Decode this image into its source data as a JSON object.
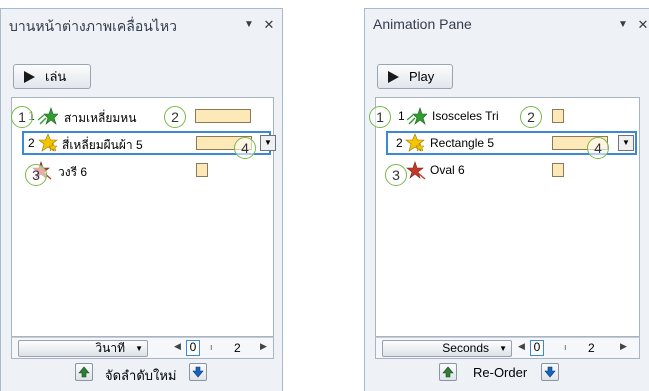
{
  "left_pane": {
    "title": "บานหน้าต่างภาพเคลื่อนไหว",
    "play_label": "เล่น",
    "rows": [
      {
        "num": "1",
        "text": "สามเหลี่ยมหน"
      },
      {
        "num": "2",
        "text": "สี่เหลี่ยมผืนผ้า 5"
      },
      {
        "num": "3",
        "text": "วงรี 6"
      }
    ],
    "seconds_label": "วินาที",
    "timeline_zero": "0",
    "timeline_two": "2",
    "reorder_label": "จัดลำดับใหม่"
  },
  "right_pane": {
    "title": "Animation Pane",
    "play_label": "Play",
    "rows": [
      {
        "num": "1",
        "text": "Isosceles Tri"
      },
      {
        "num": "2",
        "text": "Rectangle 5"
      },
      {
        "num": "3",
        "text": "Oval 6"
      }
    ],
    "seconds_label": "Seconds",
    "timeline_zero": "0",
    "timeline_two": "2",
    "reorder_label": "Re-Order"
  },
  "callouts": [
    "1",
    "2",
    "3",
    "4"
  ],
  "icons": {
    "play": "play-triangle-icon",
    "entrance": "entrance-star-icon",
    "emphasis": "emphasis-star-icon",
    "exit": "exit-star-icon",
    "dropdown": "chevron-down-icon",
    "close": "close-icon",
    "up": "arrow-up-icon",
    "down": "arrow-down-icon"
  },
  "colors": {
    "pane_bg": "#eef2f7",
    "timing_bar": "#fde9b8",
    "selection": "#3b88d4",
    "callout": "#78b84a"
  }
}
